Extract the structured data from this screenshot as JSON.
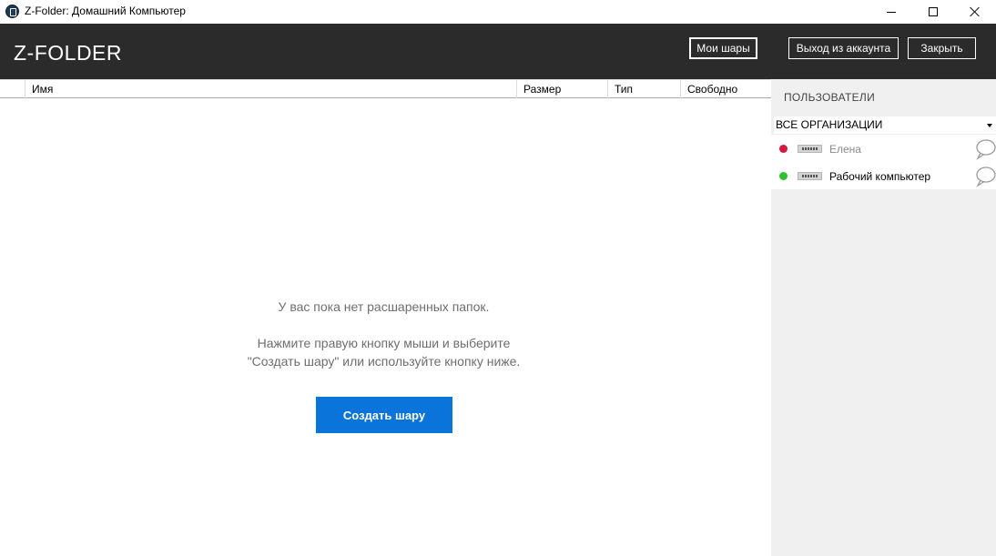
{
  "window": {
    "title": "Z-Folder: Домашний Компьютер"
  },
  "header": {
    "logo": "Z-FOLDER",
    "buttons": {
      "my_shares": "Мои шары",
      "logout": "Выход из аккаунта",
      "close": "Закрыть"
    }
  },
  "table": {
    "columns": [
      "Имя",
      "Размер",
      "Тип",
      "Свободно"
    ]
  },
  "empty_state": {
    "line1": "У вас пока нет расшаренных папок.",
    "line2": "Нажмите правую кнопку мыши и выберите",
    "line3": "\"Создать шару\" или используйте кнопку ниже.",
    "button": "Создать шару"
  },
  "sidebar": {
    "title": "ПОЛЬЗОВАТЕЛИ",
    "org_filter": "ВСЕ ОРГАНИЗАЦИИ",
    "users": [
      {
        "name": "Елена",
        "status": "offline",
        "status_color": "#d4193c",
        "icon": "chat-bubble-icon"
      },
      {
        "name": "Рабочий компьютер",
        "status": "online",
        "status_color": "#2fc22f",
        "icon": "chat-bubble-icon"
      }
    ]
  },
  "colors": {
    "header_bg": "#2b2b2b",
    "accent": "#0a74da",
    "sidebar_bg": "#f0f0f0"
  }
}
